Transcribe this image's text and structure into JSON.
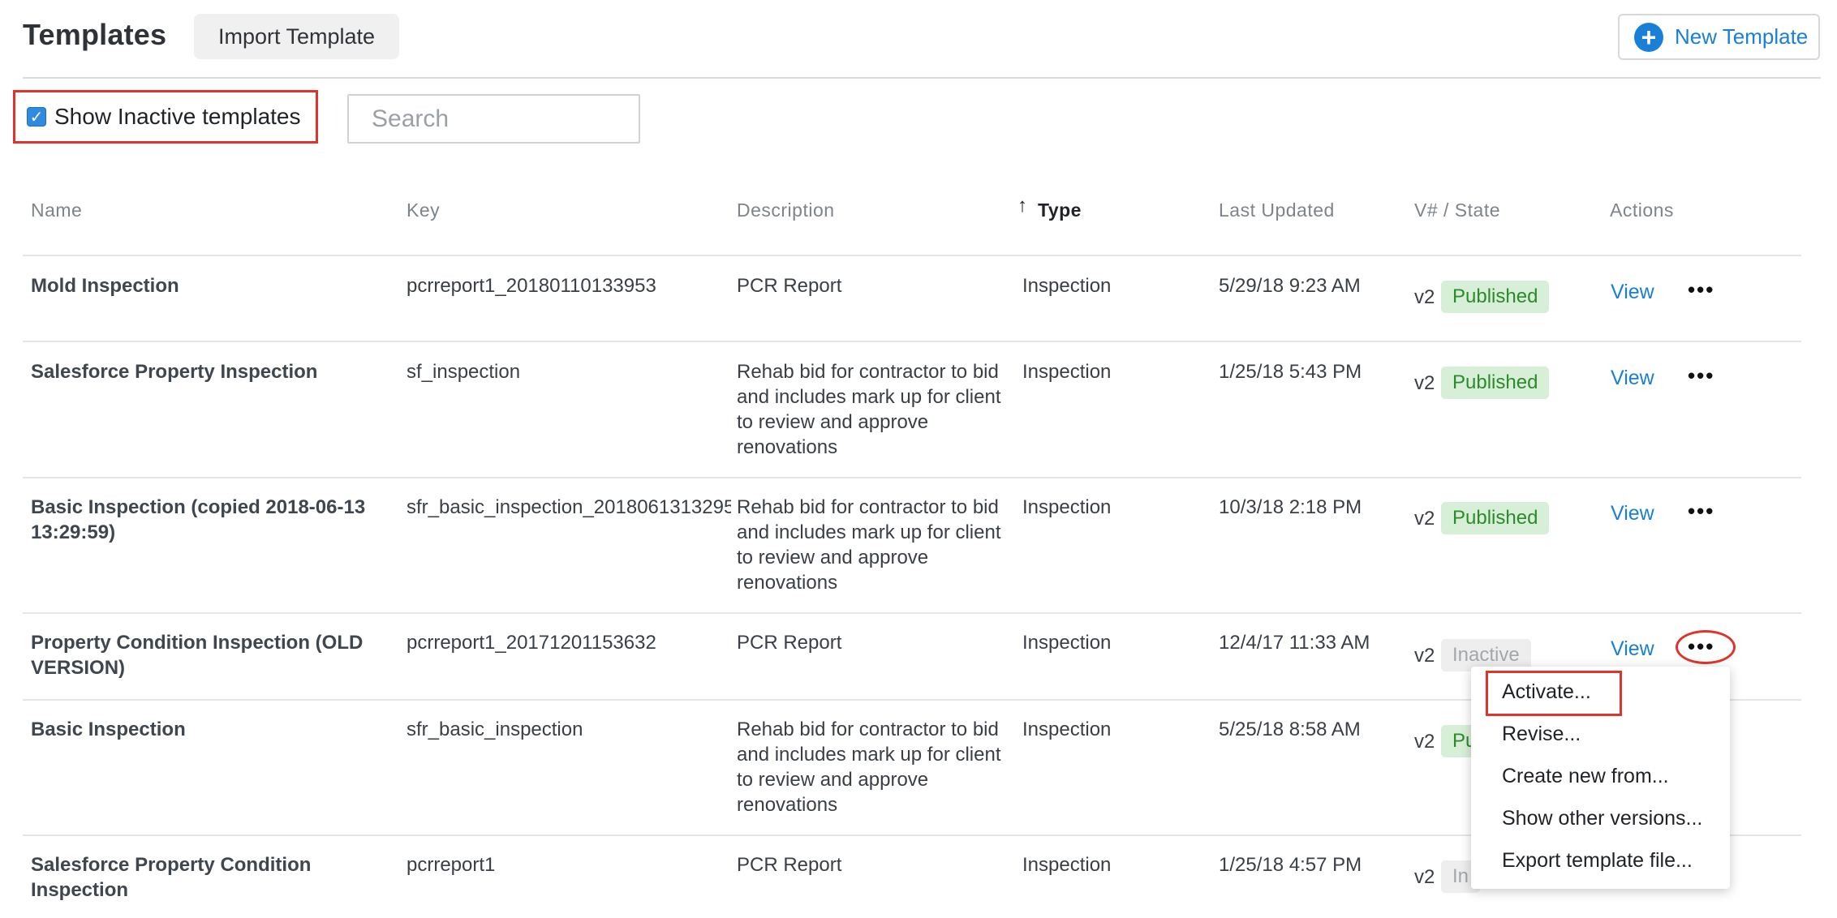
{
  "header": {
    "title": "Templates",
    "import_label": "Import Template",
    "new_label": "New Template"
  },
  "filters": {
    "show_inactive_label": "Show Inactive templates",
    "show_inactive_checked": true,
    "search_placeholder": "Search",
    "search_value": ""
  },
  "table": {
    "columns": [
      "Name",
      "Key",
      "Description",
      "Type",
      "Last Updated",
      "V# / State",
      "Actions"
    ],
    "sort_column": "Type",
    "sort_direction": "ascending",
    "rows": [
      {
        "name": "Mold Inspection",
        "key": "pcrreport1_20180110133953",
        "description": "PCR Report",
        "type": "Inspection",
        "updated": "5/29/18 9:23 AM",
        "version": "v2",
        "state": "Published",
        "action": "View"
      },
      {
        "name": "Salesforce Property Inspection",
        "key": "sf_inspection",
        "description": "Rehab bid for contractor to bid and includes mark up for client to review and approve renovations",
        "type": "Inspection",
        "updated": "1/25/18 5:43 PM",
        "version": "v2",
        "state": "Published",
        "action": "View"
      },
      {
        "name": "Basic Inspection (copied 2018-06-13 13:29:59)",
        "key": "sfr_basic_inspection_2018061313295",
        "description": "Rehab bid for contractor to bid and includes mark up for client to review and approve renovations",
        "type": "Inspection",
        "updated": "10/3/18 2:18 PM",
        "version": "v2",
        "state": "Published",
        "action": "View"
      },
      {
        "name": "Property Condition Inspection (OLD VERSION)",
        "key": "pcrreport1_20171201153632",
        "description": "PCR Report",
        "type": "Inspection",
        "updated": "12/4/17 11:33 AM",
        "version": "v2",
        "state": "Inactive",
        "action": "View"
      },
      {
        "name": "Basic Inspection",
        "key": "sfr_basic_inspection",
        "description": "Rehab bid for contractor to bid and includes mark up for client to review and approve renovations",
        "type": "Inspection",
        "updated": "5/25/18 8:58 AM",
        "version": "v2",
        "state": "Pu",
        "action": ""
      },
      {
        "name": "Salesforce Property Condition Inspection",
        "key": "pcrreport1",
        "description": "PCR Report",
        "type": "Inspection",
        "updated": "1/25/18 4:57 PM",
        "version": "v2",
        "state": "In",
        "action": ""
      }
    ],
    "more_icon": "more-horizontal-icon"
  },
  "menu": {
    "items": [
      "Activate...",
      "Revise...",
      "Create new from...",
      "Show other versions...",
      "Export template file..."
    ],
    "highlighted": "Activate..."
  },
  "colors": {
    "accent": "#1a7fd6",
    "published_bg": "#d8efd7",
    "published_text": "#2c8a2c",
    "inactive_bg": "#eeeeee",
    "inactive_text": "#a3a7ab",
    "annotation": "#e0342a"
  }
}
